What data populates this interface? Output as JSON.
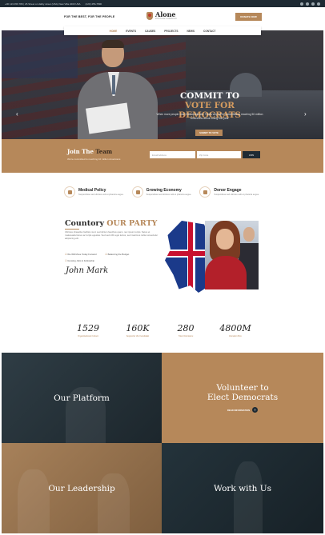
{
  "topbar": {
    "contact": "+00 123 456 789 | 26 Street on dalby street (USA) New Villa 2203 USA",
    "phone": "(123) 456-7890"
  },
  "header": {
    "slogan": "FOR THE BEST, FOR THE PEOPLE",
    "logo_name": "Alone",
    "logo_tagline": "POLITICAL CAMPAIGN",
    "donate_label": "DONATE NOW"
  },
  "nav": {
    "items": [
      {
        "label": "HOME",
        "active": true
      },
      {
        "label": "EVENTS"
      },
      {
        "label": "CAUSES"
      },
      {
        "label": "PROJECTS"
      },
      {
        "label": "NEWS"
      },
      {
        "label": "CONTACT"
      }
    ]
  },
  "hero": {
    "title_line1": "COMMIT TO",
    "title_line2": "VOTE FOR DEMOCRATS",
    "text": "When more people vote, Democrats win. That's why we're committed to reaching 50 million Americans about voting this year.",
    "button_label": "SUBMIT TO VOTE"
  },
  "join": {
    "title_a": "Join The",
    "title_b": "Team",
    "subtitle": "We're committed to reaching 10 million Americans",
    "email_placeholder": "Email Address",
    "zip_placeholder": "Zip Code",
    "button_label": "JOIN"
  },
  "features": [
    {
      "title": "Medical Policy",
      "text": "Suspendisse sed ultricies velit et pharetra augue."
    },
    {
      "title": "Growing Economy",
      "text": "Suspendisse sed ultricies velit et pharetra augue."
    },
    {
      "title": "Donor Engage",
      "text": "Suspendisse sed ultricies velit et pharetra augue."
    }
  ],
  "about": {
    "title_a": "Countory",
    "title_b": "OUR PARTY",
    "text": "Ultricies phasellus facilisis nunc sed dictum faucibus quam, nec ipsum turpis. Netus et malesuada fames ac turpis egestas. Sed sed nibh eget lectus, sed maximus nulla consectetur adipiscing elit.",
    "points": [
      "We Will Move Today Forward",
      "Balancing the Budget",
      "Growing Jobs & Fellowship"
    ],
    "signature": "John Mark"
  },
  "stats": [
    {
      "value": "1529",
      "label": "Organizational Culture"
    },
    {
      "value": "160K",
      "label": "Supporter the Candidate"
    },
    {
      "value": "280",
      "label": "Total Volunteers"
    },
    {
      "value": "4800M",
      "label": "Donation Box"
    }
  ],
  "tiles": {
    "platform": "Our Platform",
    "volunteer_line1": "Volunteer to",
    "volunteer_line2": "Elect Democrats",
    "volunteer_link": "READ INFORMATION",
    "leadership": "Our Leadership",
    "work": "Work with Us"
  },
  "colors": {
    "accent": "#b6885a",
    "dark": "#1e2a33"
  }
}
